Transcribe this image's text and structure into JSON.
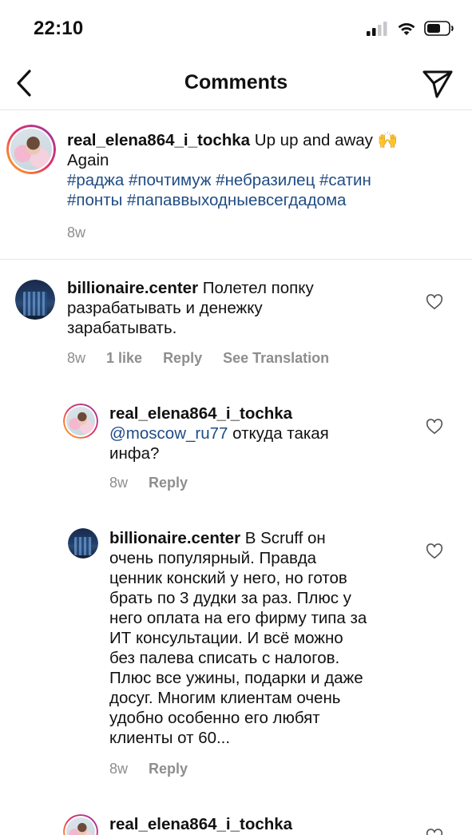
{
  "status_bar": {
    "time": "22:10"
  },
  "nav": {
    "title": "Comments"
  },
  "caption": {
    "username": "real_elena864_i_tochka",
    "text_line1": " Up up and away 🙌",
    "text_line2": "Again",
    "hashtags_line1": "#раджа #почтимуж #небразилец #сатин",
    "hashtags_line2": "#понты #папаввыходныевсегдадома",
    "time": "8w"
  },
  "comments": [
    {
      "username": "billionaire.center",
      "lines": [
        " Полетел попку",
        "разрабатывать и денежку",
        "зарабатывать."
      ],
      "time": "8w",
      "likes": "1 like",
      "reply": "Reply",
      "translation": "See Translation"
    },
    {
      "username": "real_elena864_i_tochka",
      "mention": "@moscow_ru77",
      "lines": [
        " откуда такая",
        "инфа?"
      ],
      "time": "8w",
      "reply": "Reply"
    },
    {
      "username": "billionaire.center",
      "lines": [
        " В Scruff он",
        "очень популярный.  Правда",
        "ценник конский у него,  но готов",
        "брать по 3 дудки за раз.  Плюс у",
        "него оплата на его фирму типа за",
        "ИТ консультации.  И всё можно",
        "без палева списать с налогов.",
        "Плюс все ужины, подарки и даже",
        "досуг.  Многим клиентам очень",
        "удобно особенно его любят",
        "клиенты от 60..."
      ],
      "time": "8w",
      "reply": "Reply"
    },
    {
      "username": "real_elena864_i_tochka"
    }
  ]
}
